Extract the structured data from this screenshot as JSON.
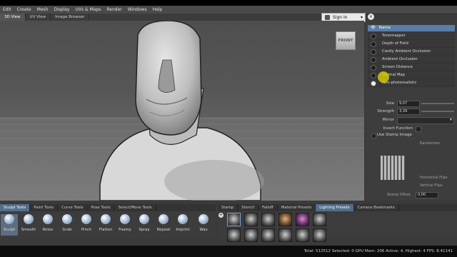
{
  "menu": [
    "Edit",
    "Create",
    "Mesh",
    "Display",
    "UVs & Maps",
    "Render",
    "Windows",
    "Help"
  ],
  "view_tabs": [
    {
      "label": "3D View",
      "active": true
    },
    {
      "label": "UV View",
      "active": false
    },
    {
      "label": "Image Browser",
      "active": false
    }
  ],
  "signin": {
    "label": "Sign In"
  },
  "close_glyph": "×",
  "viewcube": {
    "label": "FRONT"
  },
  "filters": {
    "header": "Name",
    "items": [
      {
        "label": "Tonemapper",
        "on": false
      },
      {
        "label": "Depth of Field",
        "on": false
      },
      {
        "label": "Cavity Ambient Occlusion",
        "on": false
      },
      {
        "label": "Ambient Occlusion",
        "on": false
      },
      {
        "label": "Screen Distance",
        "on": false
      },
      {
        "label": "Normal Map",
        "on": false
      },
      {
        "label": "Non-photorealistic",
        "on": true
      }
    ]
  },
  "properties": {
    "size_label": "Size",
    "size_value": "9,07",
    "strength_label": "Strength",
    "strength_value": "3,39",
    "mirror_label": "Mirror",
    "mirror_value": "",
    "invert_label": "Invert Function",
    "stamp_image_label": "Use Stamp Image",
    "randomize_label": "Randomize",
    "hflip_label": "Horizontal Flips",
    "vflip_label": "Vertical Flips",
    "stamp_offset_label": "Stamp Offset",
    "stamp_offset_value": "0,00"
  },
  "tool_tabs": [
    {
      "label": "Sculpt Tools",
      "active": true
    },
    {
      "label": "Paint Tools",
      "active": false
    },
    {
      "label": "Curve Tools",
      "active": false
    },
    {
      "label": "Pose Tools",
      "active": false
    },
    {
      "label": "Select/Move Tools",
      "active": false
    }
  ],
  "tools": [
    "Sculpt",
    "Smooth",
    "Relax",
    "Grab",
    "Pinch",
    "Flatten",
    "Foamy",
    "Spray",
    "Repeat",
    "Imprint",
    "Wax"
  ],
  "preset_tabs": [
    {
      "label": "Stamp",
      "active": false
    },
    {
      "label": "Stencil",
      "active": false
    },
    {
      "label": "Falloff",
      "active": false
    },
    {
      "label": "Material Presets",
      "active": false
    },
    {
      "label": "Lighting Presets",
      "active": true
    },
    {
      "label": "Camera Bookmarks",
      "active": false
    }
  ],
  "status": {
    "text": "Total: 512512  Selected: 0  GPU Mem: 206  Active: 4, Highest: 4  FPS: 8.41141"
  },
  "colors": {
    "accent": "#5a7ea6",
    "viewport_bg": "#575757",
    "cursor_highlight": "#d9d100"
  }
}
